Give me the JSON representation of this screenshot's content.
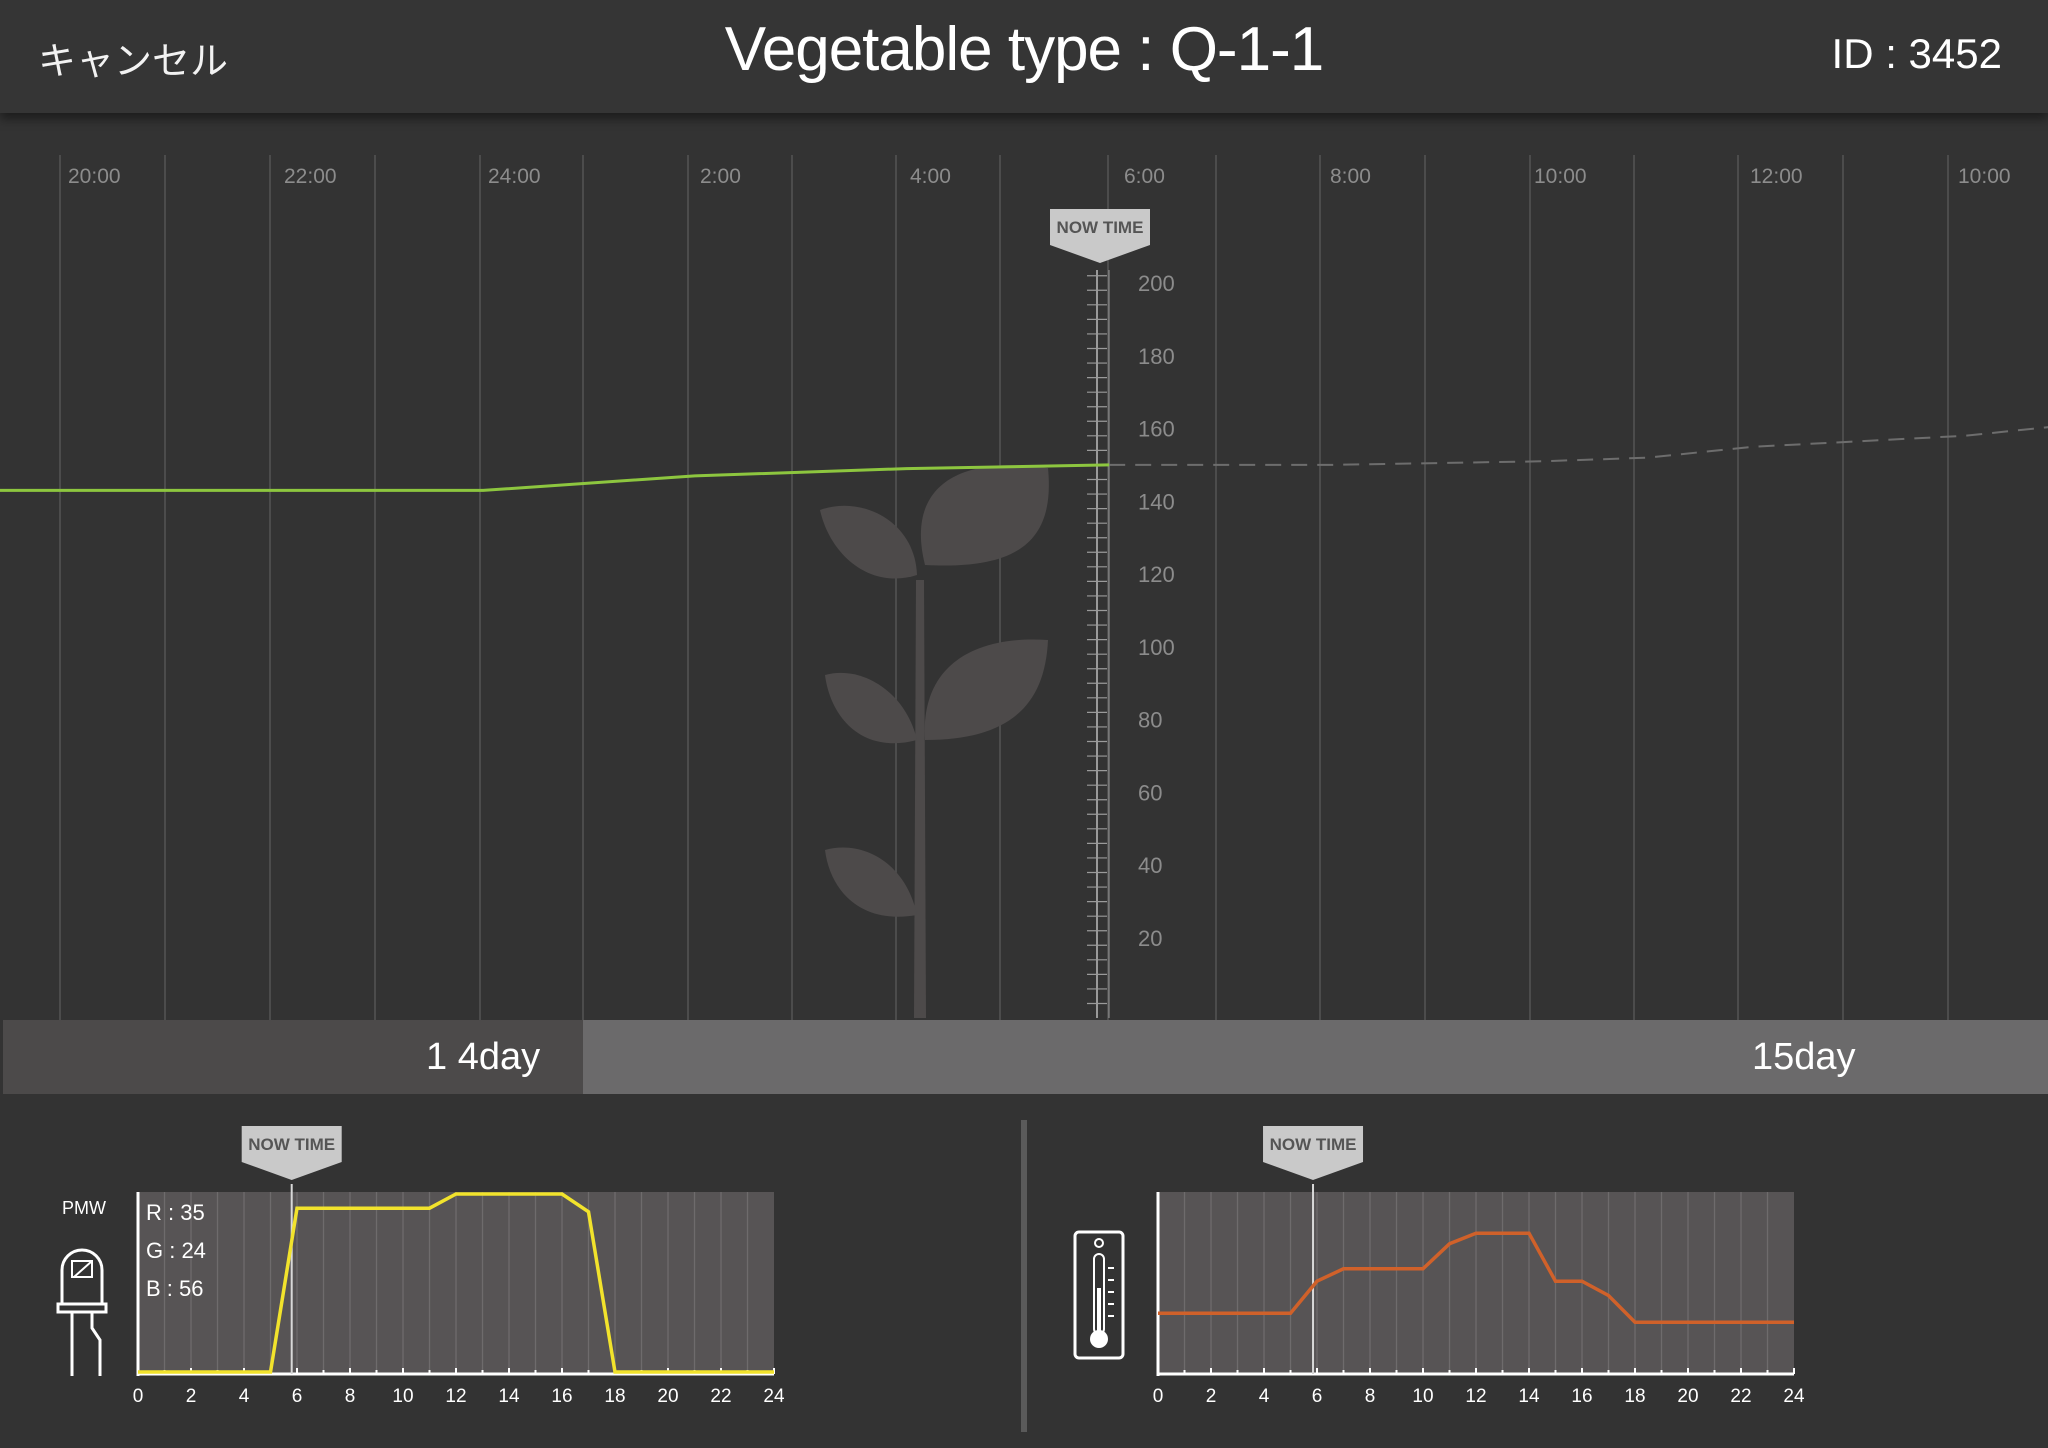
{
  "header": {
    "cancel_label": "キャンセル",
    "title": "Vegetable type : Q-1-1",
    "id_label": "ID : 3452"
  },
  "main_chart": {
    "time_labels": [
      "20:00",
      "22:00",
      "24:00",
      "2:00",
      "4:00",
      "6:00",
      "8:00",
      "10:00",
      "12:00",
      "10:00"
    ],
    "now_marker_label": "NOW TIME",
    "y_ticks": [
      "200",
      "180",
      "160",
      "140",
      "120",
      "100",
      "80",
      "60",
      "40",
      "20"
    ],
    "growth_actual_color": "#8dc63f",
    "growth_forecast_color": "#6d6d6d"
  },
  "day_bar": {
    "day_a": "1 4day",
    "day_b": "15day"
  },
  "light_panel": {
    "icon": "led-icon",
    "pmw_label": "PMW",
    "r_label": "R : 35",
    "g_label": "G : 24",
    "b_label": "B : 56",
    "now_marker_label": "NOW TIME",
    "x_ticks": [
      "0",
      "2",
      "4",
      "6",
      "8",
      "10",
      "12",
      "14",
      "16",
      "18",
      "20",
      "22",
      "24"
    ],
    "line_color": "#f2e32c"
  },
  "temp_panel": {
    "icon": "thermometer-icon",
    "now_marker_label": "NOW TIME",
    "x_ticks": [
      "0",
      "2",
      "4",
      "6",
      "8",
      "10",
      "12",
      "14",
      "16",
      "18",
      "20",
      "22",
      "24"
    ],
    "line_color": "#d0612a"
  },
  "chart_data": [
    {
      "type": "line",
      "title": "",
      "xlabel": "",
      "ylabel": "",
      "ylim": [
        0,
        200
      ],
      "series": [
        {
          "x": [
            "18:10",
            "24:00",
            "2:00",
            "4:00",
            "5:55"
          ],
          "values": [
            143,
            143,
            147,
            149,
            150
          ]
        },
        {
          "x": [
            "5:55",
            "8:00",
            "10:00",
            "11:00",
            "12:00",
            "14:00",
            "15:00"
          ],
          "values": [
            150,
            150,
            151,
            152,
            155,
            158,
            161
          ]
        }
      ],
      "grid": true
    },
    {
      "type": "line",
      "title": "",
      "xlabel": "",
      "ylabel": "",
      "xlim": [
        0,
        24
      ],
      "x": [
        0,
        5,
        6,
        11,
        12,
        16,
        17,
        18,
        24
      ],
      "series": [
        {
          "values": [
            0,
            0,
            0.92,
            0.92,
            1,
            1,
            0.9,
            0,
            0
          ]
        }
      ],
      "grid": true
    },
    {
      "type": "line",
      "title": "",
      "xlabel": "",
      "ylabel": "",
      "xlim": [
        0,
        24
      ],
      "x": [
        0,
        5,
        6,
        7,
        10,
        11,
        12,
        14,
        15,
        16,
        17,
        18,
        24
      ],
      "series": [
        {
          "values": [
            0.33,
            0.33,
            0.51,
            0.58,
            0.58,
            0.72,
            0.78,
            0.78,
            0.51,
            0.51,
            0.43,
            0.28,
            0.28
          ]
        }
      ],
      "grid": true
    }
  ]
}
